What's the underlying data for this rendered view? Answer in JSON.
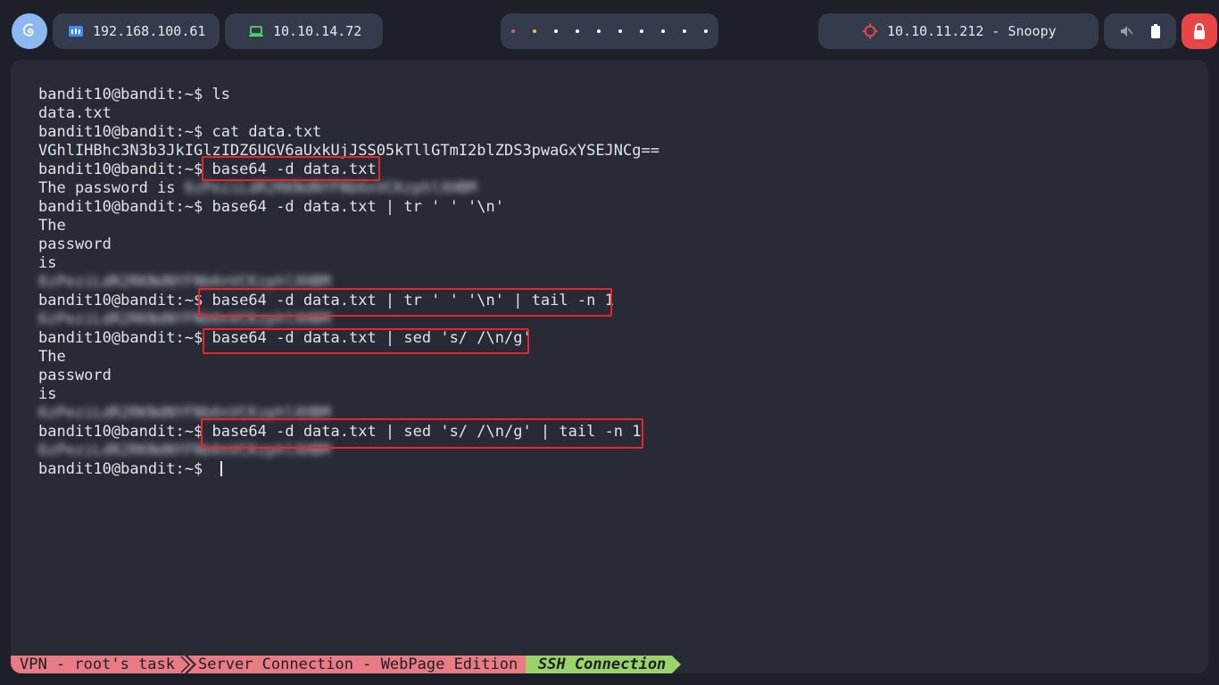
{
  "topbar": {
    "ip_local": "192.168.100.61",
    "ip_vpn": "10.10.14.72",
    "target": "10.10.11.212 - Snoopy",
    "workspace_dot_colors": [
      "#e05a5a",
      "#f0c040",
      "#ffffff",
      "#ffffff",
      "#ffffff",
      "#ffffff",
      "#ffffff",
      "#ffffff",
      "#ffffff",
      "#ffffff"
    ],
    "icons": {
      "logo": "debian-swirl-icon",
      "ip_local": "network-icon",
      "ip_vpn": "laptop-icon",
      "target": "crosshair-icon",
      "volume": "volume-muted-icon",
      "battery": "battery-icon",
      "lock": "lock-icon"
    }
  },
  "terminal": {
    "prompt": "bandit10@bandit:~$",
    "lines": [
      {
        "type": "cmd",
        "text": "ls"
      },
      {
        "type": "out",
        "text": "data.txt"
      },
      {
        "type": "cmd",
        "text": "cat data.txt"
      },
      {
        "type": "out",
        "text": "VGhlIHBhc3N3b3JkIGlzIDZ6UGV6aUxkUjJSS05kTllGTmI2blZDS3pwaGxYSEJNCg=="
      },
      {
        "type": "cmd",
        "text": "base64 -d data.txt"
      },
      {
        "type": "out",
        "text": "The password is ",
        "redacted": "6zPeziLdR2RKNdNYFNb6nVCKzphlXHBM"
      },
      {
        "type": "cmd",
        "text": "base64 -d data.txt | tr ' ' '\\n'"
      },
      {
        "type": "out",
        "text": "The"
      },
      {
        "type": "out",
        "text": "password"
      },
      {
        "type": "out",
        "text": "is"
      },
      {
        "type": "out",
        "text": "",
        "redacted": "6zPeziLdR2RKNdNYFNb6nVCKzphlXHBM"
      },
      {
        "type": "cmd",
        "text": "base64 -d data.txt | tr ' ' '\\n' | tail -n 1"
      },
      {
        "type": "out",
        "text": "",
        "redacted": "6zPeziLdR2RKNdNYFNb6nVCKzphlXHBM"
      },
      {
        "type": "cmd",
        "text": "base64 -d data.txt | sed 's/ /\\n/g'"
      },
      {
        "type": "out",
        "text": "The"
      },
      {
        "type": "out",
        "text": "password"
      },
      {
        "type": "out",
        "text": "is"
      },
      {
        "type": "out",
        "text": "",
        "redacted": "6zPeziLdR2RKNdNYFNb6nVCKzphlXHBM"
      },
      {
        "type": "cmd",
        "text": "base64 -d data.txt | sed 's/ /\\n/g' | tail -n 1"
      },
      {
        "type": "out",
        "text": "",
        "redacted": "6zPeziLdR2RKNdNYFNb6nVCKzphlXHBM"
      },
      {
        "type": "cmd",
        "text": "",
        "cursor": true
      }
    ],
    "highlight_color": "#e8262a"
  },
  "statusbar": {
    "segments": [
      {
        "label": "VPN - root's task",
        "color": "#e87b83"
      },
      {
        "label": "Server Connection - WebPage Edition",
        "color": "#e87b83"
      },
      {
        "label": "SSH Connection",
        "color": "#9ad36a",
        "active": true
      }
    ]
  }
}
